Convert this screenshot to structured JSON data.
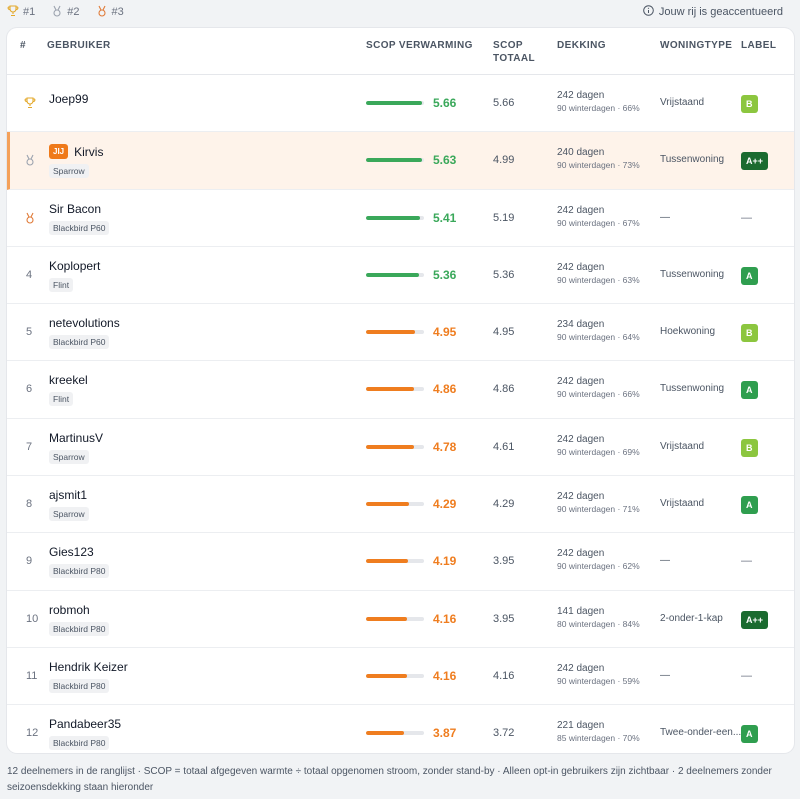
{
  "legend": {
    "items": [
      {
        "label": "#1",
        "icon": "trophy-icon",
        "color": "#e3a82a"
      },
      {
        "label": "#2",
        "icon": "medal-icon",
        "color": "#9ca3af"
      },
      {
        "label": "#3",
        "icon": "medal-icon",
        "color": "#e07b39"
      }
    ],
    "note": "Jouw rij is geaccentueerd"
  },
  "table": {
    "headers": {
      "rank": "#",
      "user": "GEBRUIKER",
      "scop_heating": "SCOP VERWARMING",
      "scop_total_1": "SCOP",
      "scop_total_2": "TOTAAL",
      "coverage": "DEKKING",
      "home_type": "WONINGTYPE",
      "label": "LABEL"
    },
    "you_badge": "JIJ",
    "rows": [
      {
        "rank": "1",
        "name": "Joep99",
        "device": "",
        "scop": "5.66",
        "scop_level": 0.97,
        "total": "5.66",
        "days": "242 dagen",
        "winter": "90 winterdagen · 66%",
        "home": "Vrijstaand",
        "label": "B",
        "highlight": false
      },
      {
        "rank": "2",
        "name": "Kirvis",
        "device": "Sparrow",
        "scop": "5.63",
        "scop_level": 0.97,
        "total": "4.99",
        "days": "240 dagen",
        "winter": "90 winterdagen · 73%",
        "home": "Tussenwoning",
        "label": "A++",
        "highlight": true
      },
      {
        "rank": "3",
        "name": "Sir Bacon",
        "device": "Blackbird P60",
        "scop": "5.41",
        "scop_level": 0.93,
        "total": "5.19",
        "days": "242 dagen",
        "winter": "90 winterdagen · 67%",
        "home": "—",
        "label": "—",
        "highlight": false
      },
      {
        "rank": "4",
        "name": "Koplopert",
        "device": "Flint",
        "scop": "5.36",
        "scop_level": 0.92,
        "total": "5.36",
        "days": "242 dagen",
        "winter": "90 winterdagen · 63%",
        "home": "Tussenwoning",
        "label": "A",
        "highlight": false
      },
      {
        "rank": "5",
        "name": "netevolutions",
        "device": "Blackbird P60",
        "scop": "4.95",
        "scop_level": 0.85,
        "total": "4.95",
        "days": "234 dagen",
        "winter": "90 winterdagen · 64%",
        "home": "Hoekwoning",
        "label": "B",
        "highlight": false
      },
      {
        "rank": "6",
        "name": "kreekel",
        "device": "Flint",
        "scop": "4.86",
        "scop_level": 0.83,
        "total": "4.86",
        "days": "242 dagen",
        "winter": "90 winterdagen · 66%",
        "home": "Tussenwoning",
        "label": "A",
        "highlight": false
      },
      {
        "rank": "7",
        "name": "MartinusV",
        "device": "Sparrow",
        "scop": "4.78",
        "scop_level": 0.82,
        "total": "4.61",
        "days": "242 dagen",
        "winter": "90 winterdagen · 69%",
        "home": "Vrijstaand",
        "label": "B",
        "highlight": false
      },
      {
        "rank": "8",
        "name": "ajsmit1",
        "device": "Sparrow",
        "scop": "4.29",
        "scop_level": 0.74,
        "total": "4.29",
        "days": "242 dagen",
        "winter": "90 winterdagen · 71%",
        "home": "Vrijstaand",
        "label": "A",
        "highlight": false
      },
      {
        "rank": "9",
        "name": "Gies123",
        "device": "Blackbird P80",
        "scop": "4.19",
        "scop_level": 0.72,
        "total": "3.95",
        "days": "242 dagen",
        "winter": "90 winterdagen · 62%",
        "home": "—",
        "label": "—",
        "highlight": false
      },
      {
        "rank": "10",
        "name": "robmoh",
        "device": "Blackbird P80",
        "scop": "4.16",
        "scop_level": 0.71,
        "total": "3.95",
        "days": "141 dagen",
        "winter": "80 winterdagen · 84%",
        "home": "2-onder-1-kap",
        "label": "A++",
        "highlight": false
      },
      {
        "rank": "11",
        "name": "Hendrik Keizer",
        "device": "Blackbird P80",
        "scop": "4.16",
        "scop_level": 0.71,
        "total": "4.16",
        "days": "242 dagen",
        "winter": "90 winterdagen · 59%",
        "home": "—",
        "label": "—",
        "highlight": false
      },
      {
        "rank": "12",
        "name": "Pandabeer35",
        "device": "Blackbird P80",
        "scop": "3.87",
        "scop_level": 0.66,
        "total": "3.72",
        "days": "221 dagen",
        "winter": "85 winterdagen · 70%",
        "home": "Twee-onder-een...",
        "label": "A",
        "highlight": false
      }
    ]
  },
  "colors": {
    "scop_high": "#3aa85a",
    "scop_mid": "#ef7d1f",
    "label_b": "#8cc63f",
    "label_a": "#2f9e4f",
    "label_app": "#1b6b30",
    "highlight_border": "#f4a15a"
  },
  "footer": "12 deelnemers in de ranglijst · SCOP = totaal afgegeven warmte ÷ totaal opgenomen stroom, zonder stand-by · Alleen opt-in gebruikers zijn zichtbaar · 2 deelnemers zonder seizoensdekking staan hieronder"
}
